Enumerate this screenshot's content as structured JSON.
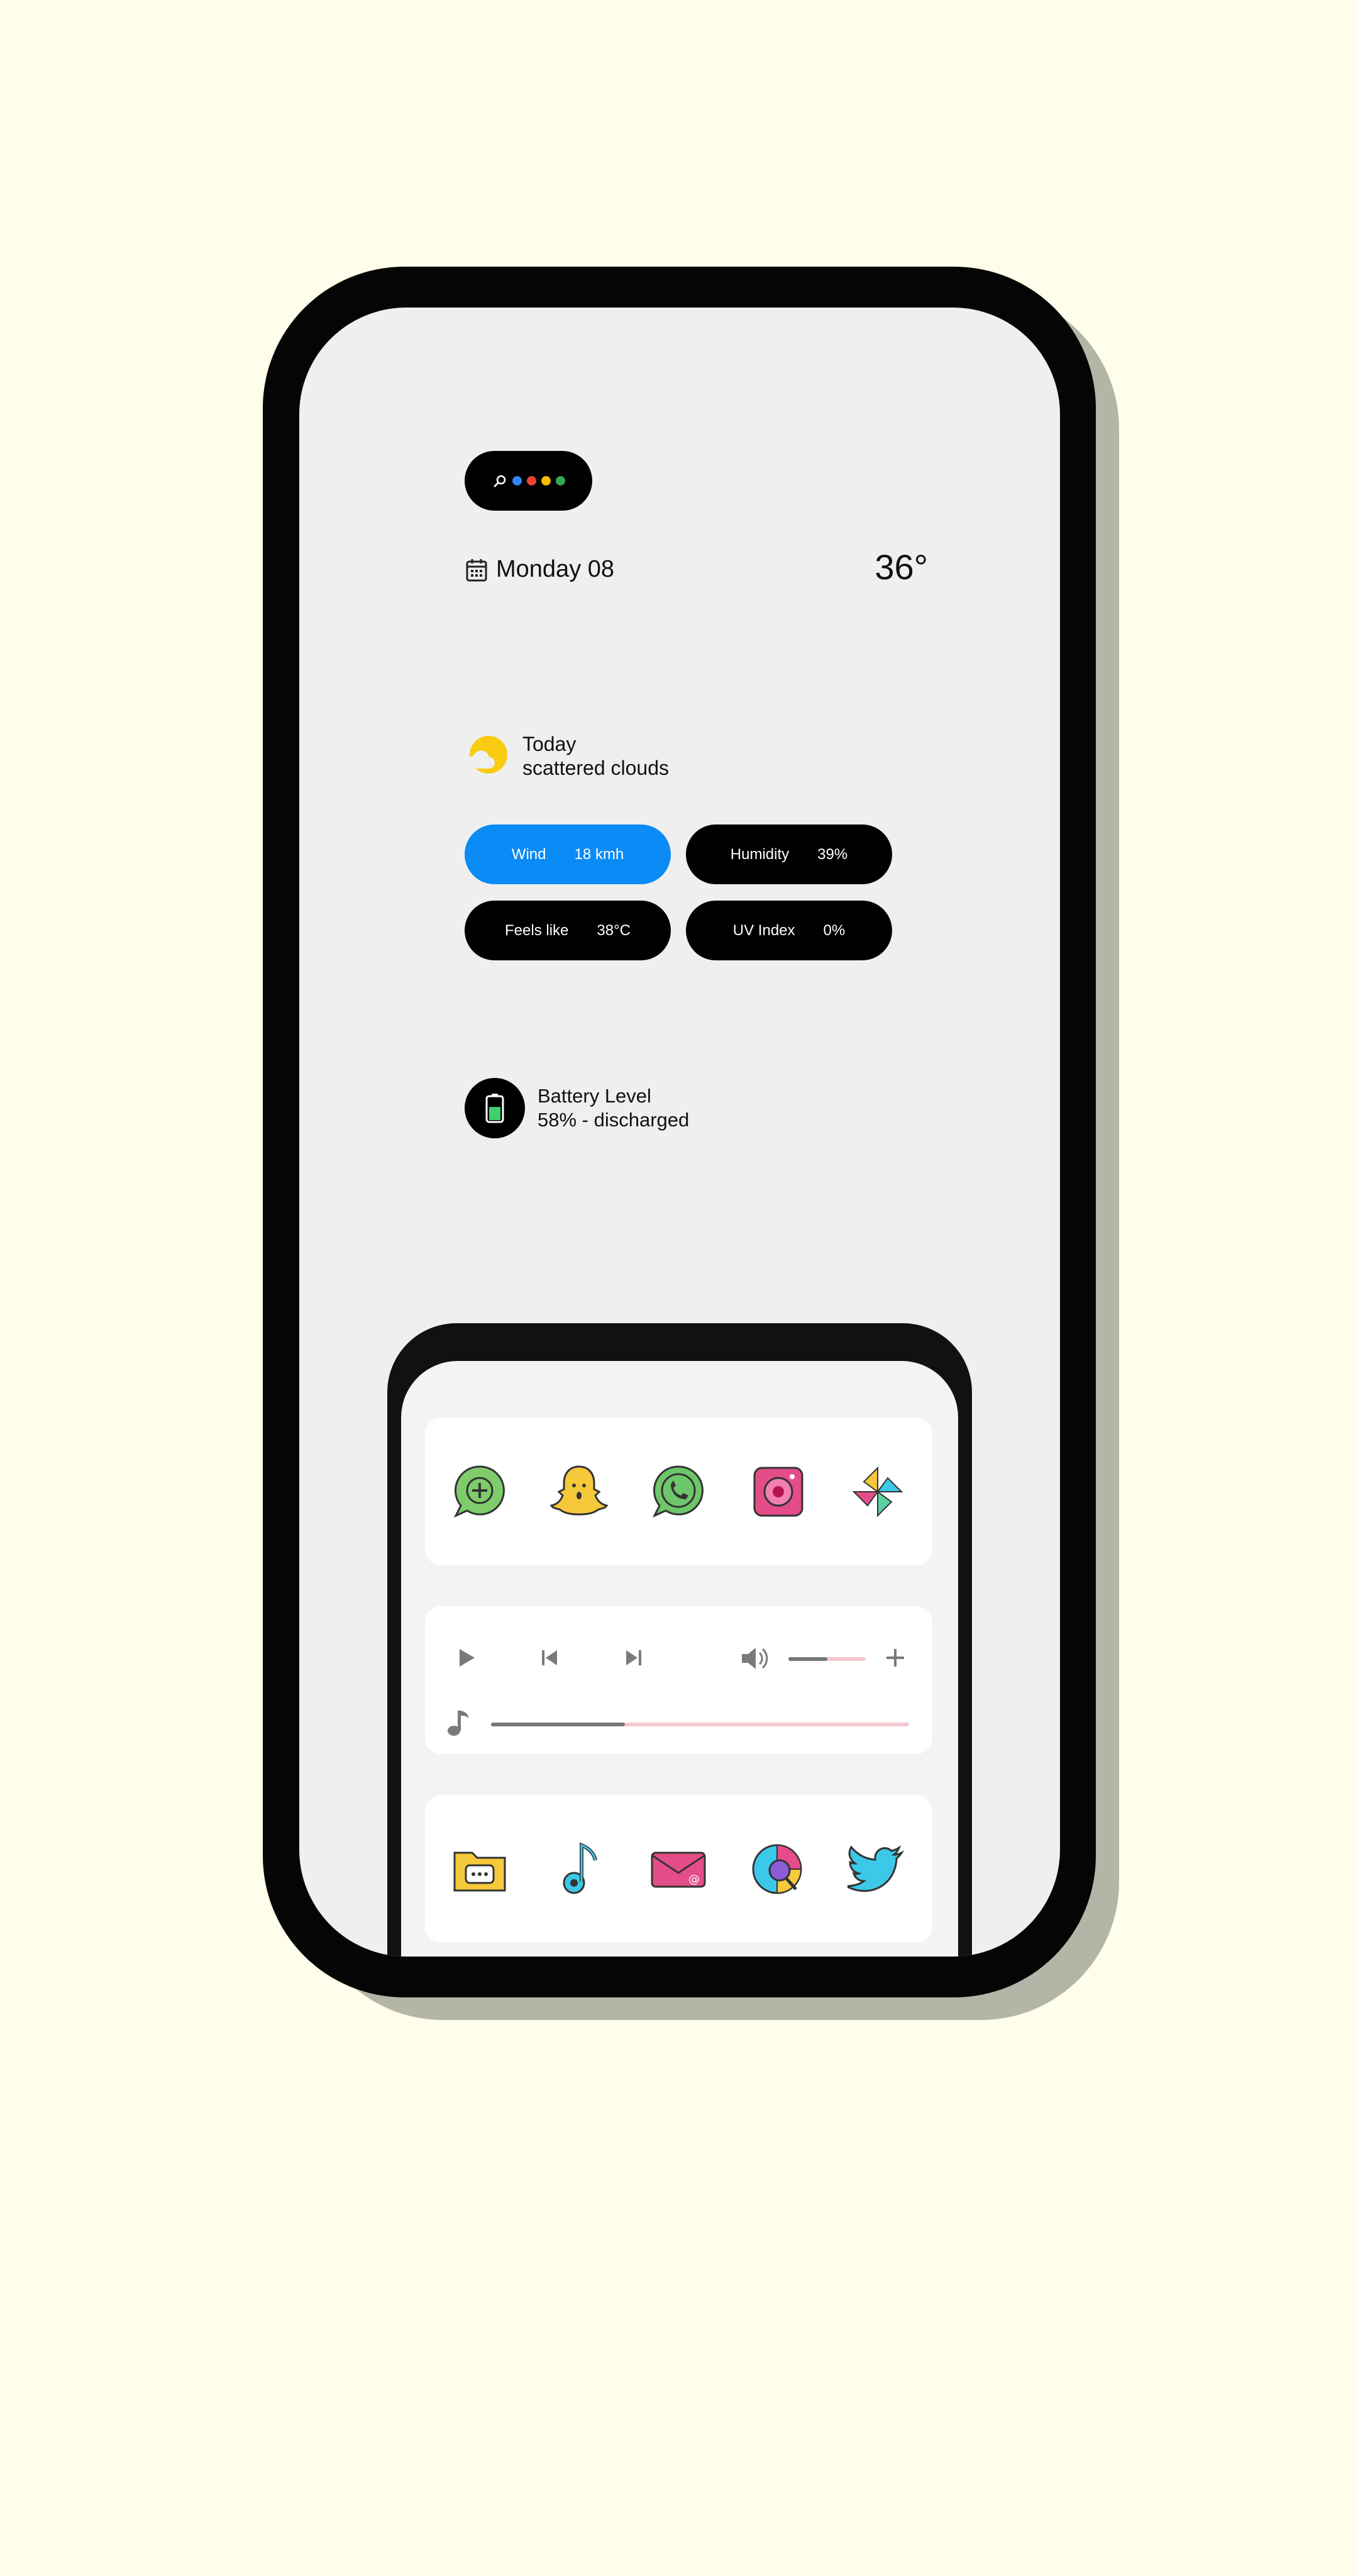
{
  "search_bar": {
    "dots": [
      "#2f86f6",
      "#ea4335",
      "#fbbc05",
      "#34a853"
    ]
  },
  "date": "Monday 08",
  "temperature": "36°",
  "weather": {
    "day": "Today",
    "condition": "scattered clouds"
  },
  "stats": [
    {
      "label": "Wind",
      "value": "18 kmh",
      "accent": "#0a8bf5"
    },
    {
      "label": "Humidity",
      "value": "39%"
    },
    {
      "label": "Feels like",
      "value": "38°C"
    },
    {
      "label": "UV Index",
      "value": "0%"
    }
  ],
  "battery": {
    "title": "Battery Level",
    "status": "58% - discharged",
    "level_percent": 58,
    "color": "#3fd16b"
  },
  "dock_row_1": [
    "plus-chat-icon",
    "snapchat-ghost-icon",
    "whatsapp-icon",
    "camera-icon",
    "pinwheel-photos-icon"
  ],
  "media": {
    "volume_fraction": 0.5,
    "progress_fraction": 0.32,
    "track_color": "#f4c8d0",
    "fill_color": "#777777"
  },
  "dock_row_2": [
    "folder-chat-icon",
    "music-note-icon",
    "email-icon",
    "finance-chart-icon",
    "twitter-bird-icon"
  ]
}
